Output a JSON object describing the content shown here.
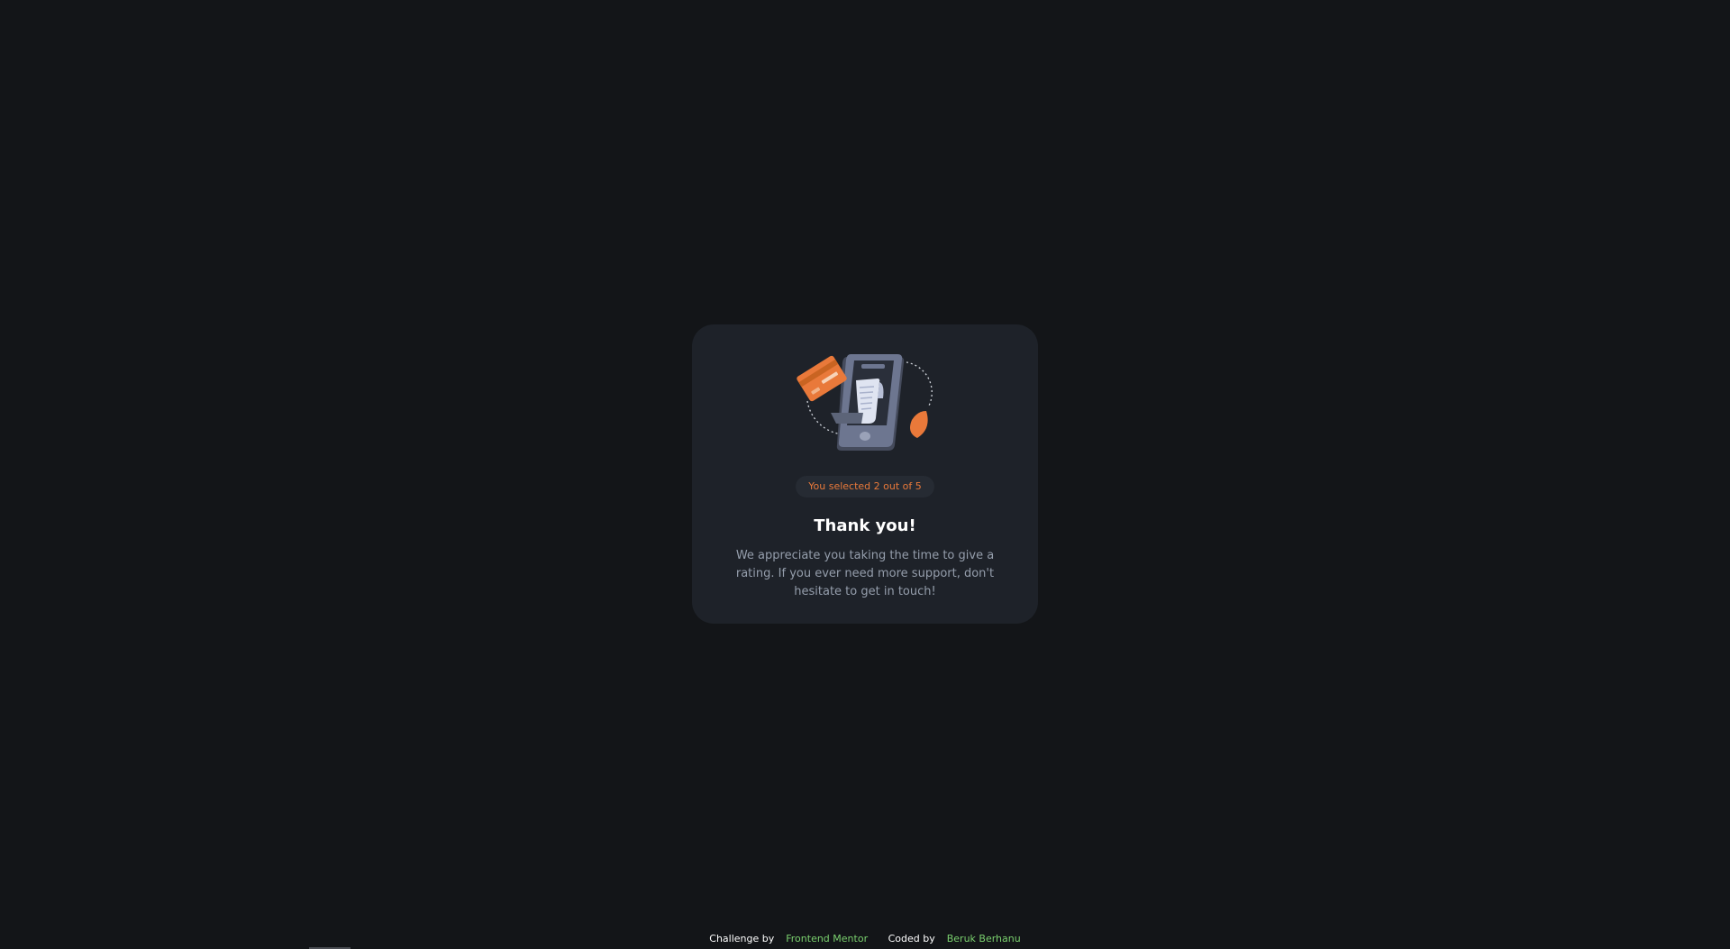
{
  "card": {
    "illustration_icon": "payment-phone-illustration",
    "badge_text": "You selected 2 out of 5",
    "title": "Thank you!",
    "message": "We appreciate you taking the time to give a rating. If you ever need more support, don't hesitate to get in touch!"
  },
  "footer": {
    "challenge_label": "Challenge by",
    "challenge_link": "Frontend Mentor",
    "coded_label": "Coded by",
    "coded_link": "Beruk Berhanu"
  },
  "colors": {
    "background": "#131518",
    "card": "#1e2229",
    "accent": "#e9793a",
    "link": "#7ad06e",
    "body_text": "#959eac"
  }
}
